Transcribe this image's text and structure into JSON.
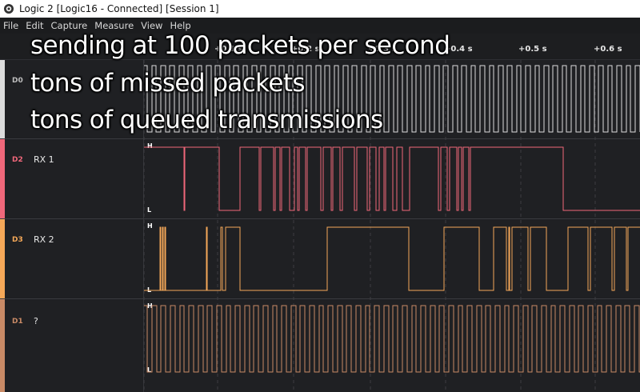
{
  "window": {
    "title": "Logic 2 [Logic16 - Connected] [Session 1]"
  },
  "menu": [
    "File",
    "Edit",
    "Capture",
    "Measure",
    "View",
    "Help"
  ],
  "ruler": {
    "ticks": [
      "+0.1 s",
      "+0.2 s",
      "+0.3 s",
      "+0.4 s",
      "+0.5 s",
      "+0.6 s"
    ]
  },
  "levels": {
    "high": "H",
    "low": "L"
  },
  "channels": [
    {
      "id": "D0",
      "name": "",
      "color": "#dcdcdc"
    },
    {
      "id": "D2",
      "name": "RX 1",
      "color": "#f0677a"
    },
    {
      "id": "D3",
      "name": "RX 2",
      "color": "#f5a858"
    },
    {
      "id": "D1",
      "name": "?",
      "color": "#c98a66"
    }
  ],
  "overlay_caption": [
    "sending at 100 packets per second",
    "tons of missed packets",
    "tons of queued transmissions"
  ]
}
